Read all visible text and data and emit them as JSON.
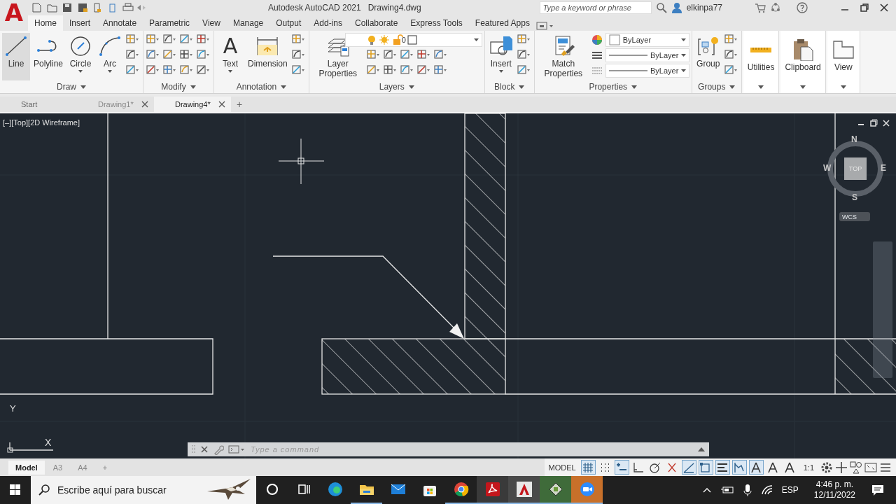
{
  "title_bar": {
    "logo": "A",
    "app": "Autodesk AutoCAD 2021",
    "file": "Drawing4.dwg",
    "search_placeholder": "Type a keyword or phrase",
    "user": "elkinpa77"
  },
  "ribbon_tabs": [
    {
      "label": "Home",
      "selected": true
    },
    {
      "label": "Insert",
      "selected": false
    },
    {
      "label": "Annotate",
      "selected": false
    },
    {
      "label": "Parametric",
      "selected": false
    },
    {
      "label": "View",
      "selected": false
    },
    {
      "label": "Manage",
      "selected": false
    },
    {
      "label": "Output",
      "selected": false
    },
    {
      "label": "Add-ins",
      "selected": false
    },
    {
      "label": "Collaborate",
      "selected": false
    },
    {
      "label": "Express Tools",
      "selected": false
    },
    {
      "label": "Featured Apps",
      "selected": false
    }
  ],
  "panels": [
    {
      "kind": "draw",
      "title": "Draw",
      "tools": [
        {
          "kind": "line",
          "label": "Line",
          "selected": true,
          "dropdown": false
        },
        {
          "kind": "polyline",
          "label": "Polyline",
          "selected": false,
          "dropdown": false
        },
        {
          "kind": "circle",
          "label": "Circle",
          "selected": false,
          "dropdown": true
        },
        {
          "kind": "arc",
          "label": "Arc",
          "selected": false,
          "dropdown": true
        }
      ]
    },
    {
      "kind": "modify",
      "title": "Modify"
    },
    {
      "kind": "annotation",
      "title": "Annotation",
      "tools": [
        {
          "kind": "text",
          "glyph": "A",
          "label": "Text",
          "selected": false,
          "dropdown": true
        },
        {
          "kind": "dimension",
          "label": "Dimension",
          "selected": false,
          "dropdown": false
        }
      ]
    },
    {
      "kind": "layers",
      "title": "Layers",
      "tools": [
        {
          "kind": "layers",
          "label": "Layer Properties",
          "selected": false,
          "dropdown": false
        }
      ],
      "combos": [
        {
          "kind": "layer",
          "value": "0"
        }
      ]
    },
    {
      "kind": "block",
      "title": "Block",
      "tools": [
        {
          "kind": "insert",
          "label": "Insert",
          "selected": false,
          "dropdown": true
        }
      ]
    },
    {
      "kind": "properties",
      "title": "Properties",
      "tools": [
        {
          "kind": "match",
          "label": "Match Properties",
          "selected": false,
          "dropdown": false
        }
      ],
      "combos": [
        {
          "kind": "color",
          "value": "ByLayer"
        },
        {
          "kind": "linetype",
          "value": "ByLayer"
        },
        {
          "kind": "lineweight",
          "value": "ByLayer"
        }
      ]
    },
    {
      "kind": "groups",
      "title": "Groups",
      "tools": [
        {
          "kind": "group",
          "label": "Group",
          "selected": false,
          "dropdown": false
        }
      ]
    },
    {
      "kind": "utilities",
      "tools": [
        {
          "kind": "ruler",
          "label": "Utilities",
          "selected": false,
          "dropdown": false
        }
      ]
    },
    {
      "kind": "clipboard",
      "tools": [
        {
          "kind": "clipboard",
          "label": "Clipboard",
          "selected": false,
          "dropdown": false
        }
      ]
    },
    {
      "kind": "view",
      "tools": [
        {
          "kind": "view",
          "label": "View",
          "selected": false,
          "dropdown": false
        }
      ]
    }
  ],
  "doc_tabs": [
    {
      "label": "Start",
      "selected": false,
      "closable": false
    },
    {
      "label": "Drawing1*",
      "selected": false,
      "closable": true
    },
    {
      "label": "Drawing4*",
      "selected": true,
      "closable": true
    }
  ],
  "new_tab": "+",
  "viewport": {
    "label": "[–][Top][2D Wireframe]"
  },
  "viewcube": {
    "face": "TOP",
    "north": "N",
    "south": "S",
    "east": "E",
    "west": "W",
    "ucs_menu": "WCS"
  },
  "ucs": {
    "x": "X",
    "y": "Y"
  },
  "command_line": {
    "placeholder": "Type a command"
  },
  "layout_tabs": [
    {
      "label": "Model",
      "selected": true
    },
    {
      "label": "A3",
      "selected": false
    },
    {
      "label": "A4",
      "selected": false
    }
  ],
  "new_layout": "+",
  "status_bar": {
    "mode": "MODEL",
    "scale": "1:1",
    "toggles": [
      {
        "kind": "grid",
        "on": true
      },
      {
        "kind": "snap",
        "on": false
      },
      {
        "kind": "infer",
        "on": true
      },
      {
        "kind": "ortho",
        "on": false
      },
      {
        "kind": "polar",
        "on": false
      },
      {
        "kind": "iso",
        "on": false
      },
      {
        "kind": "track",
        "on": true
      },
      {
        "kind": "osnap",
        "on": true
      },
      {
        "kind": "lineweight",
        "on": true
      },
      {
        "kind": "transparency",
        "on": true
      },
      {
        "kind": "annomonitor",
        "on": true
      },
      {
        "kind": "autoscale",
        "on": false
      },
      {
        "kind": "annoscale",
        "on": false
      }
    ]
  },
  "taskbar": {
    "search_placeholder": "Escribe aquí para buscar",
    "apps": [
      {
        "kind": "cortana",
        "running": false
      },
      {
        "kind": "taskview",
        "running": false
      },
      {
        "kind": "edge",
        "running": false
      },
      {
        "kind": "explorer",
        "running": true
      },
      {
        "kind": "mail",
        "running": false
      },
      {
        "kind": "store",
        "running": false
      },
      {
        "kind": "chrome",
        "running": true
      },
      {
        "kind": "acrobat",
        "running": true
      },
      {
        "kind": "autocad",
        "running": true
      },
      {
        "kind": "viewer",
        "running": true
      },
      {
        "kind": "zoom",
        "running": true
      }
    ],
    "language": "ESP",
    "time": "4:46 p. m.",
    "date": "12/11/2022"
  }
}
